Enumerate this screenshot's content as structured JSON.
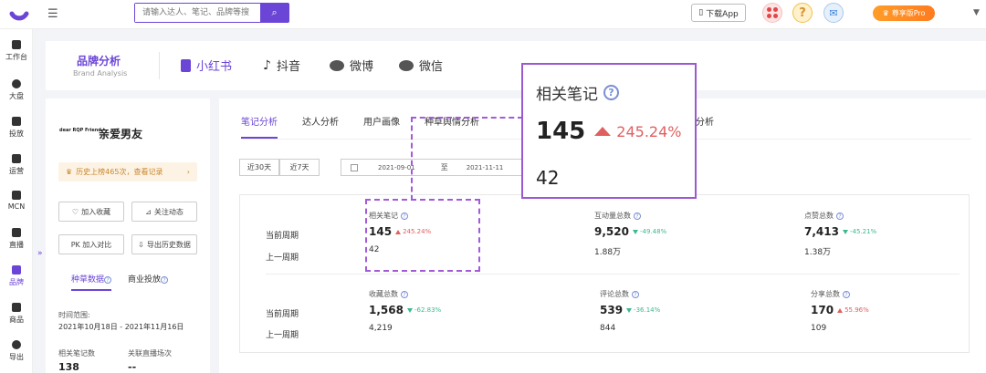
{
  "header": {
    "search_placeholder": "请输入达人、笔记、品牌等搜",
    "download_label": "下载App",
    "pro_label": "尊享版Pro"
  },
  "rail": {
    "items": [
      "工作台",
      "大盘",
      "投放",
      "运营",
      "MCN",
      "直播",
      "品牌",
      "商品",
      "导出"
    ],
    "active_index": 6
  },
  "brand": {
    "title": "品牌分析",
    "subtitle": "Brand Analysis",
    "platforms": [
      "小红书",
      "抖音",
      "微博",
      "微信"
    ],
    "active_platform": 0
  },
  "left_panel": {
    "logo_text": "dear RQP Friend",
    "brand_name": "亲爱男友",
    "history": "历史上榜465次，查看记录",
    "buttons": {
      "collect": "加入收藏",
      "follow": "关注动态",
      "compare": "PK 加入对比",
      "export": "导出历史数据"
    },
    "tabs": [
      "种草数据",
      "商业投放"
    ],
    "time_label": "时间范围:",
    "time_value": "2021年10月18日 - 2021年11月16日",
    "stat1_label": "相关笔记数",
    "stat1_value": "138",
    "stat2_label": "关联直播场次",
    "stat2_value": "--"
  },
  "main": {
    "tabs": [
      "笔记分析",
      "达人分析",
      "用户画像",
      "种草舆情分析"
    ],
    "tab_tail": "分析",
    "period_buttons": [
      "近30天",
      "近7天"
    ],
    "date_start": "2021-09-01",
    "date_sep": "至",
    "date_end": "2021-11-11",
    "row_current": "当前周期",
    "row_previous": "上一周期",
    "metrics": [
      {
        "name": "相关笔记",
        "value": "145",
        "change": "245.24%",
        "dir": "up",
        "prev": "42"
      },
      {
        "name": "互动量总数",
        "value": "9,520",
        "change": "-49.48%",
        "dir": "down",
        "prev": "1.88万"
      },
      {
        "name": "点赞总数",
        "value": "7,413",
        "change": "-45.21%",
        "dir": "down",
        "prev": "1.38万"
      },
      {
        "name": "收藏总数",
        "value": "1,568",
        "change": "-62.83%",
        "dir": "down",
        "prev": "4,219"
      },
      {
        "name": "评论总数",
        "value": "539",
        "change": "-36.14%",
        "dir": "down",
        "prev": "844"
      },
      {
        "name": "分享总数",
        "value": "170",
        "change": "55.96%",
        "dir": "up",
        "prev": "109"
      }
    ]
  },
  "zoom": {
    "name": "相关笔记",
    "value": "145",
    "change": "245.24%",
    "prev": "42"
  },
  "colors": {
    "accent": "#6b45d6",
    "up": "#e06060",
    "down": "#3cb98f",
    "highlight": "#9b59d0"
  }
}
